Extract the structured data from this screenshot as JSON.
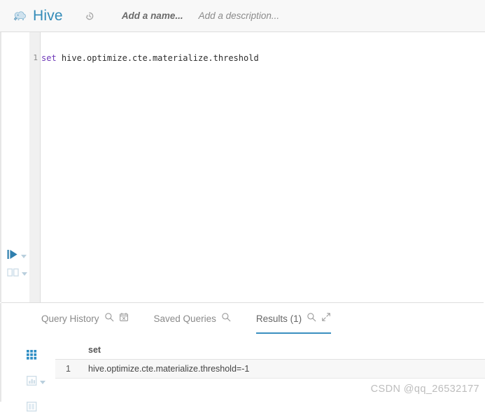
{
  "header": {
    "brand_name": "Hive",
    "logo_icon": "hive-elephant-icon",
    "history_icon": "history-clock-icon",
    "name_placeholder": "Add a name...",
    "description_placeholder": "Add a description..."
  },
  "editor": {
    "line_number": "1",
    "code_keyword": "set",
    "code_rest": " hive.optimize.cte.materialize.threshold",
    "run_icon": "play-run-icon",
    "run_caret_icon": "chevron-down-icon",
    "book_icon": "open-book-icon",
    "book_caret_icon": "chevron-down-icon"
  },
  "tabs": [
    {
      "label": "Query History",
      "active": false,
      "icons": [
        "search-icon",
        "calendar-clear-icon"
      ]
    },
    {
      "label": "Saved Queries",
      "active": false,
      "icons": [
        "search-icon"
      ]
    },
    {
      "label": "Results (1)",
      "active": true,
      "icons": [
        "search-icon",
        "expand-arrows-icon"
      ]
    }
  ],
  "results": {
    "view_modes": [
      {
        "icon": "grid-table-icon",
        "active": true,
        "has_caret": false
      },
      {
        "icon": "bar-chart-icon",
        "active": false,
        "has_caret": true
      },
      {
        "icon": "columns-panel-icon",
        "active": false,
        "has_caret": false
      }
    ],
    "columns": [
      "set"
    ],
    "rows": [
      {
        "num": "1",
        "values": [
          "hive.optimize.cte.materialize.threshold=-1"
        ]
      }
    ]
  },
  "watermark": "CSDN @qq_26532177",
  "colors": {
    "brand_blue": "#338bb8",
    "accent_blue": "#3a8fc0",
    "header_bg": "#f8f8f8",
    "gutter_bg": "#f0f0f0",
    "keyword_purple": "#6e39b8",
    "row_bg": "#f7f7f7",
    "muted_text": "#8a8a8a"
  }
}
